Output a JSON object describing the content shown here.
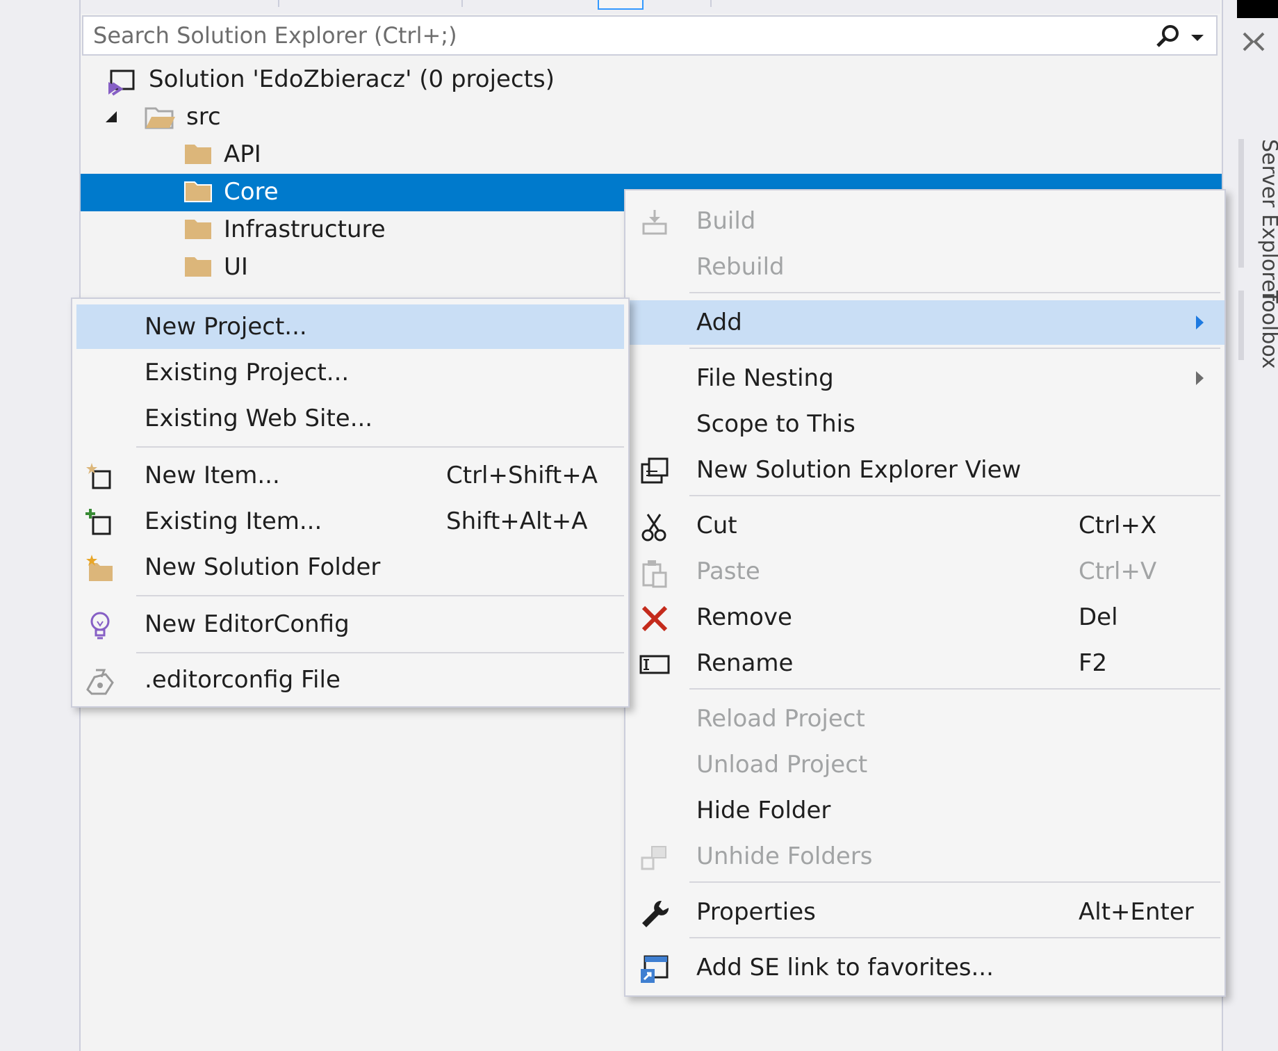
{
  "search": {
    "placeholder": "Search Solution Explorer (Ctrl+;)"
  },
  "tree": {
    "solution": "Solution 'EdoZbieracz' (0 projects)",
    "items": [
      {
        "label": "src"
      },
      {
        "label": "API"
      },
      {
        "label": "Core"
      },
      {
        "label": "Infrastructure"
      },
      {
        "label": "UI"
      }
    ]
  },
  "side_tabs": {
    "server_explorer": "Server Explorer",
    "toolbox": "Toolbox"
  },
  "context_menu": {
    "items": [
      {
        "label": "Build",
        "icon": "build-icon"
      },
      {
        "label": "Rebuild"
      },
      {
        "label": "Add"
      },
      {
        "label": "File Nesting"
      },
      {
        "label": "Scope to This"
      },
      {
        "label": "New Solution Explorer View",
        "icon": "new-view-icon"
      },
      {
        "label": "Cut",
        "shortcut": "Ctrl+X",
        "icon": "scissors-icon"
      },
      {
        "label": "Paste",
        "shortcut": "Ctrl+V",
        "icon": "paste-icon"
      },
      {
        "label": "Remove",
        "shortcut": "Del",
        "icon": "remove-icon"
      },
      {
        "label": "Rename",
        "shortcut": "F2",
        "icon": "rename-icon"
      },
      {
        "label": "Reload Project"
      },
      {
        "label": "Unload Project"
      },
      {
        "label": "Hide Folder"
      },
      {
        "label": "Unhide Folders",
        "icon": "unhide-icon"
      },
      {
        "label": "Properties",
        "shortcut": "Alt+Enter",
        "icon": "wrench-icon"
      },
      {
        "label": "Add SE link to favorites...",
        "icon": "favorites-link-icon"
      }
    ]
  },
  "add_submenu": {
    "items": [
      {
        "label": "New Project..."
      },
      {
        "label": "Existing Project..."
      },
      {
        "label": "Existing Web Site..."
      },
      {
        "label": "New Item...",
        "shortcut": "Ctrl+Shift+A",
        "icon": "new-item-icon"
      },
      {
        "label": "Existing Item...",
        "shortcut": "Shift+Alt+A",
        "icon": "existing-item-icon"
      },
      {
        "label": "New Solution Folder",
        "icon": "new-folder-icon"
      },
      {
        "label": "New EditorConfig",
        "icon": "lightbulb-icon"
      },
      {
        "label": ".editorconfig File",
        "icon": "editorconfig-icon"
      }
    ]
  },
  "colors": {
    "selection": "#007acc",
    "menu_highlight": "#c9def5",
    "folder": "#dcb67a",
    "remove": "#c42b1c"
  }
}
